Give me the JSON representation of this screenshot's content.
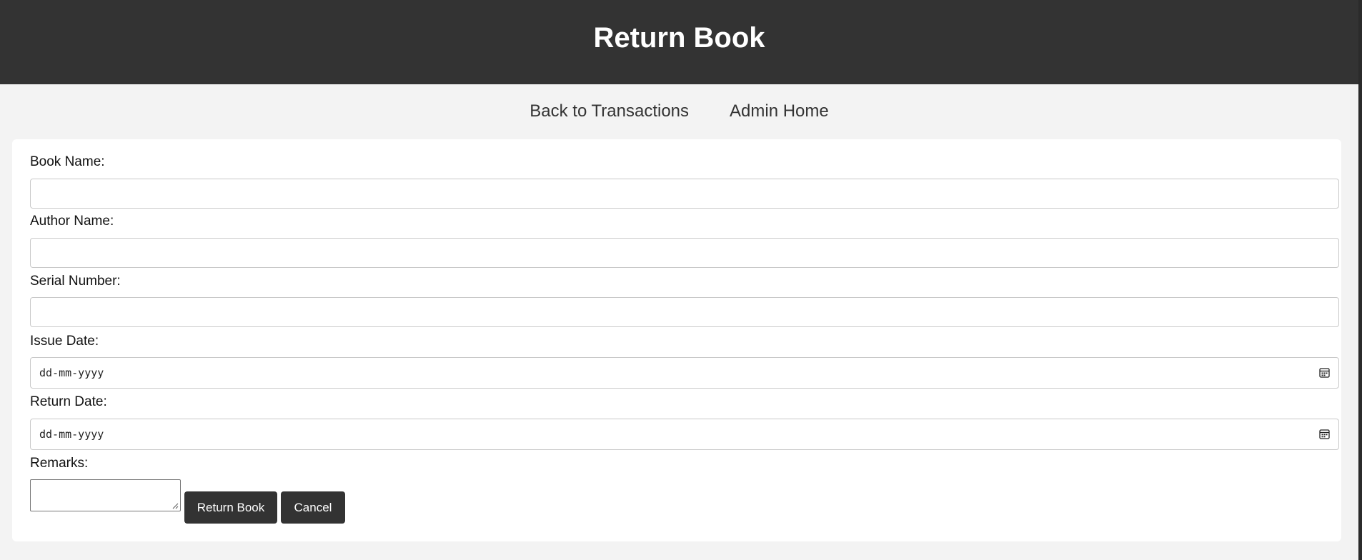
{
  "header": {
    "title": "Return Book"
  },
  "nav": {
    "links": [
      {
        "label": "Back to Transactions"
      },
      {
        "label": "Admin Home"
      }
    ]
  },
  "form": {
    "book_name": {
      "label": "Book Name:",
      "value": ""
    },
    "author_name": {
      "label": "Author Name:",
      "value": ""
    },
    "serial_number": {
      "label": "Serial Number:",
      "value": ""
    },
    "issue_date": {
      "label": "Issue Date:",
      "placeholder": "dd-mm-yyyy"
    },
    "return_date": {
      "label": "Return Date:",
      "placeholder": "dd-mm-yyyy"
    },
    "remarks": {
      "label": "Remarks:",
      "value": ""
    },
    "submit_label": "Return Book",
    "cancel_label": "Cancel"
  },
  "colors": {
    "header_bg": "#333333",
    "page_bg": "#f3f3f3",
    "card_bg": "#ffffff",
    "button_bg": "#333333"
  },
  "icons": {
    "date_picker": "calendar-icon",
    "textarea_resize": "resize-grip-icon"
  }
}
